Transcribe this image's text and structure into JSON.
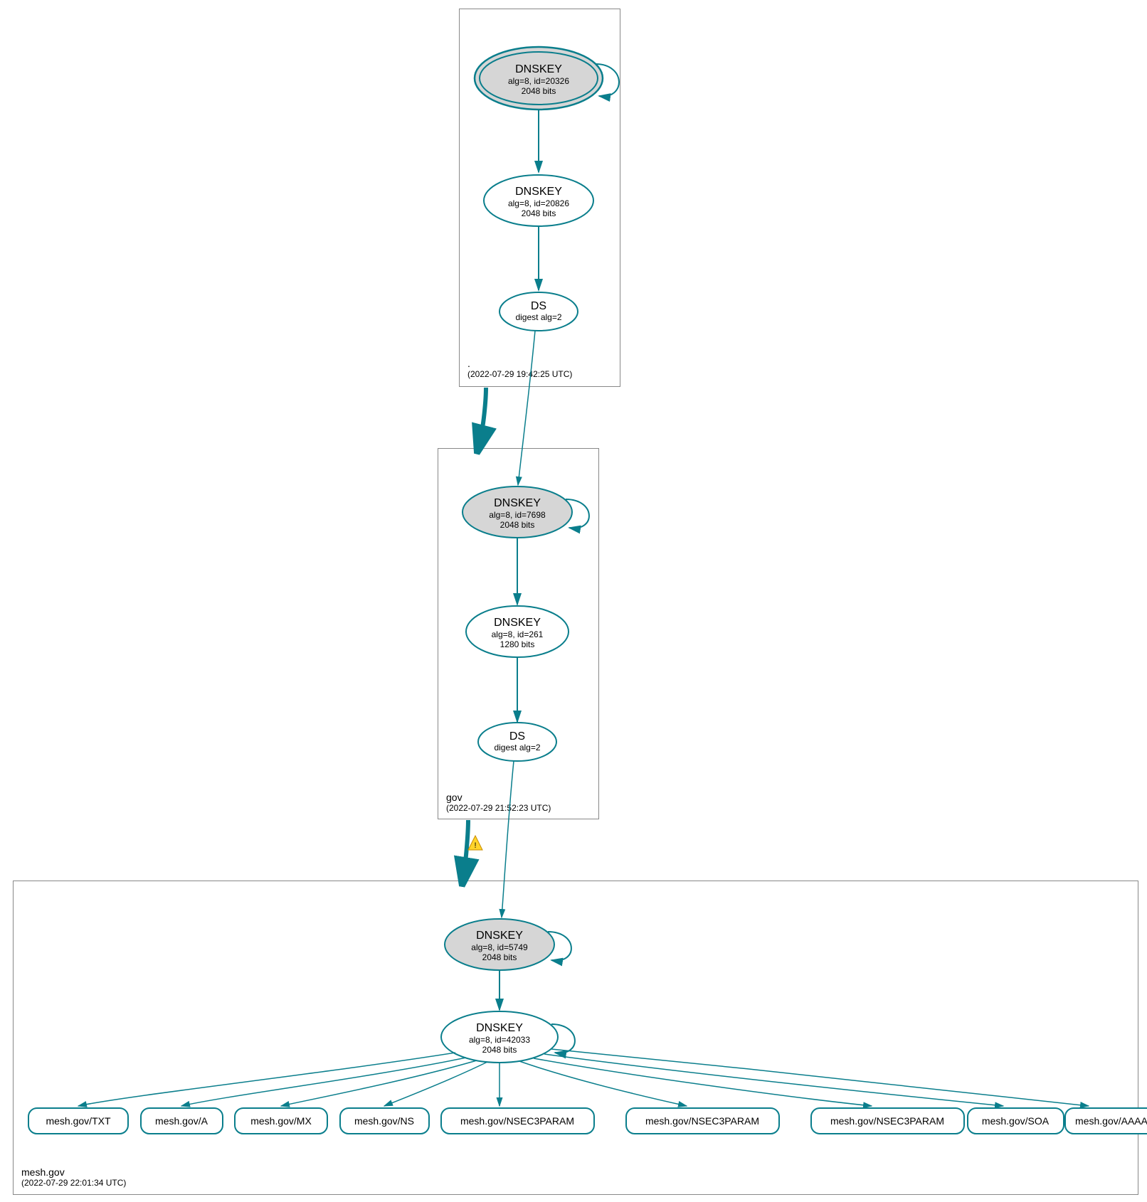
{
  "colors": {
    "teal": "#0a7e8c",
    "teal_dark": "#0b6d7a",
    "box_border": "#888888",
    "grey_fill": "#d6d6d6",
    "white": "#ffffff",
    "black": "#000000"
  },
  "zones": {
    "root": {
      "name": ".",
      "timestamp": "(2022-07-29 19:42:25 UTC)"
    },
    "gov": {
      "name": "gov",
      "timestamp": "(2022-07-29 21:52:23 UTC)"
    },
    "mesh": {
      "name": "mesh.gov",
      "timestamp": "(2022-07-29 22:01:34 UTC)"
    }
  },
  "nodes": {
    "root_ksk": {
      "title": "DNSKEY",
      "line1": "alg=8, id=20326",
      "line2": "2048 bits"
    },
    "root_zsk": {
      "title": "DNSKEY",
      "line1": "alg=8, id=20826",
      "line2": "2048 bits"
    },
    "root_ds": {
      "title": "DS",
      "line1": "digest alg=2",
      "line2": ""
    },
    "gov_ksk": {
      "title": "DNSKEY",
      "line1": "alg=8, id=7698",
      "line2": "2048 bits"
    },
    "gov_zsk": {
      "title": "DNSKEY",
      "line1": "alg=8, id=261",
      "line2": "1280 bits"
    },
    "gov_ds": {
      "title": "DS",
      "line1": "digest alg=2",
      "line2": ""
    },
    "mesh_ksk": {
      "title": "DNSKEY",
      "line1": "alg=8, id=5749",
      "line2": "2048 bits"
    },
    "mesh_zsk": {
      "title": "DNSKEY",
      "line1": "alg=8, id=42033",
      "line2": "2048 bits"
    }
  },
  "rrsets": {
    "r0": "mesh.gov/TXT",
    "r1": "mesh.gov/A",
    "r2": "mesh.gov/MX",
    "r3": "mesh.gov/NS",
    "r4": "mesh.gov/NSEC3PARAM",
    "r5": "mesh.gov/NSEC3PARAM",
    "r6": "mesh.gov/NSEC3PARAM",
    "r7": "mesh.gov/SOA",
    "r8": "mesh.gov/AAAA"
  },
  "warning_icon": "⚠"
}
